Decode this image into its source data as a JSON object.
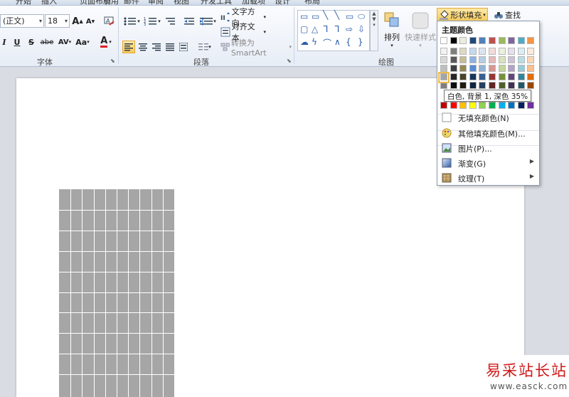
{
  "tabs": [
    "开始",
    "插入",
    "页面布局",
    "引用",
    "邮件",
    "审阅",
    "视图",
    "开发工具",
    "加载项",
    "设计",
    "布局"
  ],
  "ribbon": {
    "font": {
      "font_name": "(正文)",
      "font_size": "18",
      "group_label": "字体",
      "grow": "A",
      "shrink": "A",
      "italic": "I",
      "underline": "U",
      "strike": "S",
      "strike2": "abe",
      "spacing": "AV",
      "case": "Aa",
      "color_a": "A",
      "color": "#e02020"
    },
    "paragraph": {
      "group_label": "段落",
      "text_direction": "文字方向",
      "align_text": "对齐文本",
      "smartart": "转换为 SmartArt"
    },
    "drawing": {
      "group_label": "绘图",
      "arrange": "排列",
      "quick_styles": "快速样式",
      "shape_fill": "形状填充",
      "find": "查找"
    }
  },
  "fill_menu": {
    "title": "主题颜色",
    "theme_top": [
      "#ffffff",
      "#000000",
      "#eeece1",
      "#1f497d",
      "#4f81bd",
      "#c0504d",
      "#9bbb59",
      "#8064a2",
      "#4bacc6",
      "#f79646"
    ],
    "theme_shades": [
      [
        "#f2f2f2",
        "#7f7f7f",
        "#ddd9c3",
        "#c6d9f0",
        "#dbe5f1",
        "#f2dcdb",
        "#ebf1dd",
        "#e5e0ec",
        "#dbeef3",
        "#fdeada"
      ],
      [
        "#d8d8d8",
        "#595959",
        "#c4bd97",
        "#8db3e2",
        "#b8cce4",
        "#e5b9b7",
        "#d7e3bc",
        "#ccc1d9",
        "#b7dde8",
        "#fbd5b5"
      ],
      [
        "#bfbfbf",
        "#3f3f3f",
        "#938953",
        "#548dd4",
        "#95b3d7",
        "#d99694",
        "#c3d69b",
        "#b2a2c7",
        "#92cddc",
        "#fac08f"
      ],
      [
        "#a5a5a5",
        "#262626",
        "#494429",
        "#17365d",
        "#366092",
        "#953734",
        "#76923c",
        "#5f497a",
        "#31859b",
        "#e36c09"
      ],
      [
        "#7f7f7f",
        "#0c0c0c",
        "#1d1b10",
        "#0f243e",
        "#244061",
        "#632423",
        "#4f6128",
        "#3f3151",
        "#205867",
        "#974806"
      ]
    ],
    "standard_colors": [
      "#c00000",
      "#ff0000",
      "#ffc000",
      "#ffff00",
      "#92d050",
      "#00b050",
      "#00b0f0",
      "#0070c0",
      "#002060",
      "#7030a0"
    ],
    "items": [
      {
        "label": "无填充颜色(N)",
        "icon": "no-fill-icon",
        "submenu": false
      },
      {
        "label": "其他填充颜色(M)...",
        "icon": "color-palette-icon",
        "submenu": false
      },
      {
        "label": "图片(P)...",
        "icon": "picture-icon",
        "submenu": false
      },
      {
        "label": "渐变(G)",
        "icon": "gradient-icon",
        "submenu": true
      },
      {
        "label": "纹理(T)",
        "icon": "texture-icon",
        "submenu": true
      }
    ]
  },
  "tooltip": "白色, 背景 1, 深色 35%",
  "table": {
    "columns": 10,
    "rows": 10,
    "fill": "#a6a6a6"
  },
  "watermark": {
    "text": "易采站长站",
    "url": "www.easck.com"
  }
}
